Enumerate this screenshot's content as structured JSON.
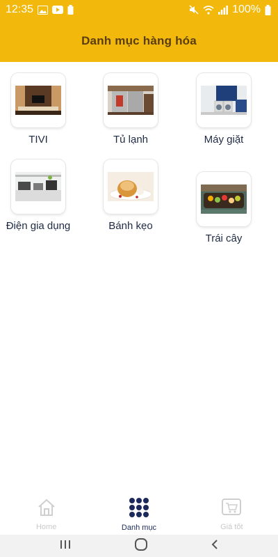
{
  "status_bar": {
    "time": "12:35",
    "battery": "100%",
    "icons_left": [
      "image-icon",
      "youtube-icon",
      "battery-saver-icon"
    ],
    "icons_right": [
      "mute-icon",
      "wifi-icon",
      "signal-icon",
      "battery-icon"
    ]
  },
  "header": {
    "title": "Danh mục hàng hóa"
  },
  "categories": [
    {
      "label": "TIVI",
      "icon": "tv-room-photo"
    },
    {
      "label": "Tủ lạnh",
      "icon": "fridge-photo"
    },
    {
      "label": "Máy giặt",
      "icon": "laundry-photo"
    },
    {
      "label": "Điện gia dụng",
      "icon": "kitchen-appliance-photo"
    },
    {
      "label": "Bánh kẹo",
      "icon": "cake-photo"
    },
    {
      "label": "Trái cây",
      "icon": "fruit-boat-photo"
    }
  ],
  "bottom_nav": {
    "items": [
      {
        "label": "Home",
        "icon": "home-icon",
        "active": false
      },
      {
        "label": "Danh mục",
        "icon": "grid-dots-icon",
        "active": true
      },
      {
        "label": "Giá tốt",
        "icon": "shopping-cart-icon",
        "active": false
      }
    ]
  },
  "system_nav": {
    "icons": [
      "recent-apps-icon",
      "home-circle-icon",
      "back-icon"
    ]
  },
  "colors": {
    "primary": "#f2b90c",
    "title_text": "#5a3d12",
    "active_nav": "#1b2a5a",
    "inactive_nav": "#c9c9c9"
  }
}
